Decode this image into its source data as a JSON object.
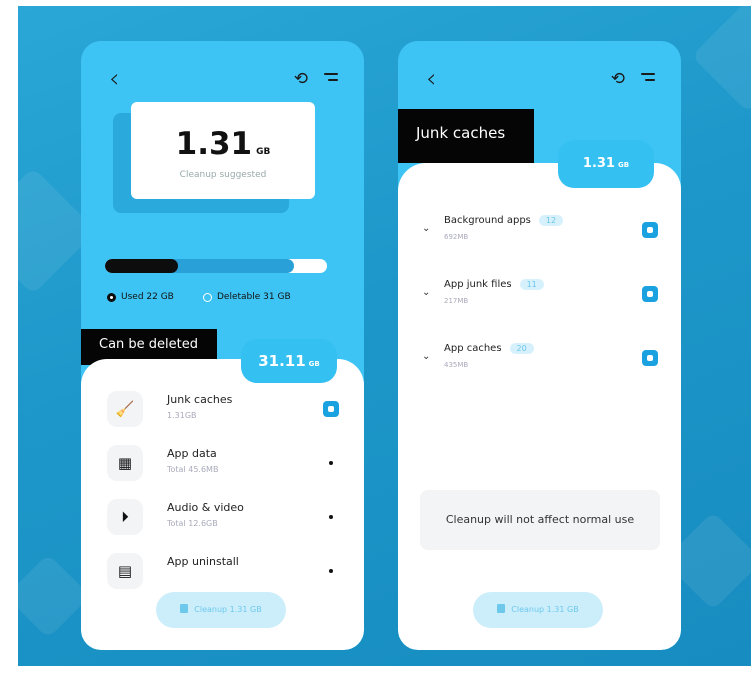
{
  "left_screen": {
    "cleanup_size": "1.31",
    "cleanup_unit": "GB",
    "cleanup_caption": "Cleanup suggested",
    "storage": {
      "used_fraction": 0.33,
      "deletable_fraction": 0.85
    },
    "legend_used": "Used 22 GB",
    "legend_deletable": "Deletable 31 GB",
    "section_title": "Can be deleted",
    "deletable_size": "31.11",
    "deletable_unit": "GB",
    "items": [
      {
        "title": "Junk caches",
        "subtitle": "1.31GB",
        "icon": "broom-icon"
      },
      {
        "title": "App data",
        "subtitle": "Total 45.6MB",
        "icon": "grid-icon"
      },
      {
        "title": "Audio & video",
        "subtitle": "Total 12.6GB",
        "icon": "play-icon"
      },
      {
        "title": "App uninstall",
        "subtitle": "",
        "icon": "apps-icon"
      }
    ],
    "cleanup_button": "Cleanup 1.31 GB"
  },
  "right_screen": {
    "section_title": "Junk caches",
    "size": "1.31",
    "unit": "GB",
    "items": [
      {
        "title": "Background apps",
        "count": "12",
        "size": "692MB"
      },
      {
        "title": "App junk files",
        "count": "11",
        "size": "217MB"
      },
      {
        "title": "App caches",
        "count": "20",
        "size": "435MB"
      }
    ],
    "info_text": "Cleanup will not affect normal use",
    "cleanup_button": "Cleanup 1.31 GB"
  },
  "colors": {
    "accent": "#3ec4f4",
    "primary": "#1aa2e0",
    "dark": "#050505",
    "background": "#1d97c9"
  }
}
